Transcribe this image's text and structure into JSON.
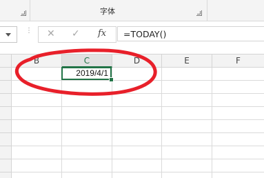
{
  "ribbon": {
    "group_label": "字体"
  },
  "formula_bar": {
    "cancel_icon": "✕",
    "enter_icon": "✓",
    "fx_label": "fx",
    "formula": "=TODAY()"
  },
  "columns": [
    "B",
    "C",
    "D",
    "E",
    "F"
  ],
  "selected_column": "C",
  "active_cell": {
    "value": "2019/4/1"
  },
  "colors": {
    "accent": "#217346",
    "annotation": "#e8202a"
  }
}
